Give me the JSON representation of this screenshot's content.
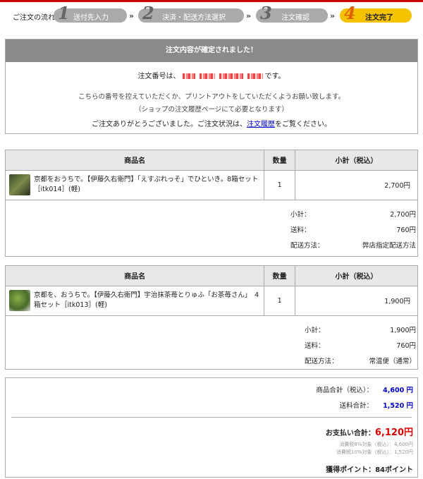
{
  "steps": {
    "lead": "ご注文の流れ：",
    "items": [
      {
        "num": "1",
        "label": "送付先入力"
      },
      {
        "num": "2",
        "label": "決済・配送方法選択"
      },
      {
        "num": "3",
        "label": "注文確認"
      },
      {
        "num": "4",
        "label": "注文完了"
      }
    ],
    "arrow": "»"
  },
  "confirm": {
    "heading": "注文内容が確定されました！",
    "order_prefix": "注文番号は、",
    "order_suffix": "です。",
    "note1": "こちらの番号を控えていただくか、プリントアウトをしていただくようお願い致します。",
    "note2": "（ショップの注文履歴ページにて必要となります）",
    "thanks_prefix": "ご注文ありがとうございました。ご注文状況は、",
    "history_link": "注文履歴",
    "thanks_suffix": "をご覧ください。"
  },
  "columns": {
    "name": "商品名",
    "qty": "数量",
    "subtotal": "小計（税込）"
  },
  "orders": [
    {
      "product": "京都をおうちで。【伊藤久右衛門】「えすぷれっそ」でひといき。8箱セット［itk014］(軽)",
      "qty": "1",
      "subtotal": "2,700円",
      "summary_subtotal_label": "小計：",
      "summary_subtotal": "2,700円",
      "shipping_label": "送料：",
      "shipping": "760円",
      "method_label": "配送方法：",
      "method": "弊店指定配送方法"
    },
    {
      "product": "京都を、おうちで。【伊藤久右衛門】宇治抹茶苺とりゅふ「お茶苺さん」　4箱セット［itk013］(軽)",
      "qty": "1",
      "subtotal": "1,900円",
      "summary_subtotal_label": "小計：",
      "summary_subtotal": "1,900円",
      "shipping_label": "送料：",
      "shipping": "760円",
      "method_label": "配送方法：",
      "method": "常温便（通常）"
    }
  ],
  "totals": {
    "goods_label": "商品合計（税込）：",
    "goods": "4,600 円",
    "shipping_label": "送料合計：",
    "shipping": "1,520 円",
    "pay_label": "お支払い合計：",
    "pay": "6,120円",
    "tax8": "消費税8%対象（税込）：4,600円",
    "tax10": "消費税10%対象（税込）：1,520円",
    "points": "獲得ポイント：84ポイント"
  },
  "colors": {
    "accent": "#c00000",
    "active_step": "#f5c200",
    "link": "#0000cc",
    "total": "#dd0000"
  }
}
